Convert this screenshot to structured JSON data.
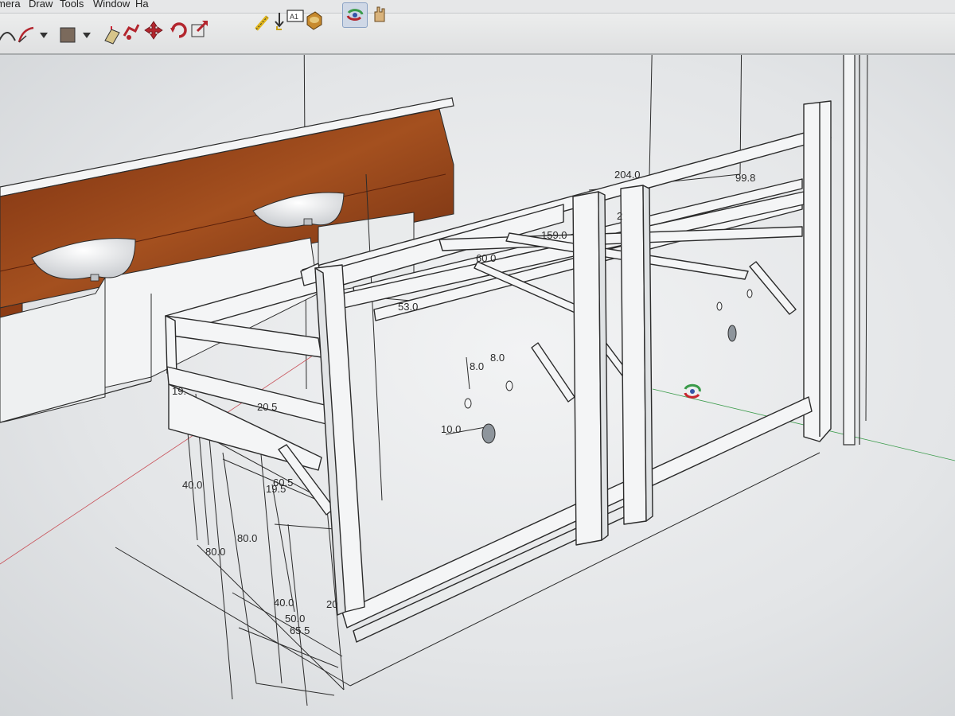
{
  "menubar": {
    "items": [
      "mera",
      "Draw",
      "Tools",
      "Window",
      "Ha"
    ]
  },
  "toolbar": {
    "tools": [
      {
        "icon": "arc-icon"
      },
      {
        "icon": "paint-bucket-icon"
      },
      {
        "icon": "offset-icon"
      },
      {
        "icon": "follow-me-icon"
      },
      {
        "icon": "move-icon"
      },
      {
        "icon": "rotate-icon"
      },
      {
        "icon": "scale-icon"
      },
      {
        "icon": "tape-measure-icon"
      },
      {
        "icon": "dimension-icon"
      },
      {
        "icon": "text-icon"
      },
      {
        "icon": "section-plane-icon"
      },
      {
        "icon": "orbit-icon"
      }
    ],
    "text_tool_label": "A1"
  },
  "dimensions": {
    "overall_length": "204.0",
    "right_depth": "99.8",
    "inner_length": "159.0",
    "top_width": "60.0",
    "top_depth": "53.0",
    "hole_a": "8.0",
    "hole_b": "8.0",
    "hole_offset": "10.0",
    "left_height": "19.",
    "rail_height": "20.5",
    "rail_span": "60.5",
    "rail_gap": "19.5",
    "height_a": "40.0",
    "height_b": "80.0",
    "height_c": "80.0",
    "depth_a": "40.0",
    "depth_b": "50.0",
    "depth_c": "65.5",
    "front_gap": "20",
    "small_label": "2"
  },
  "colors": {
    "viewport_bg": "#e8eaec",
    "wood": "#8a3a14",
    "frame_light": "#f4f5f6",
    "frame_edge": "#2b2b2b",
    "sink": "#ffffff",
    "axis_red": "#c8525a",
    "axis_green": "#3a9b4a"
  }
}
